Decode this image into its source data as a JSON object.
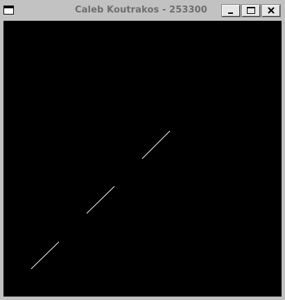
{
  "window": {
    "title": "Caleb Koutrakos - 253300",
    "icons": {
      "system_menu": "window-menu-icon",
      "minimize": "minimize-icon",
      "maximize": "maximize-icon",
      "close": "close-icon"
    }
  },
  "canvas": {
    "background": "#000000",
    "stroke_color": "#ffffff",
    "line_count": 3
  }
}
